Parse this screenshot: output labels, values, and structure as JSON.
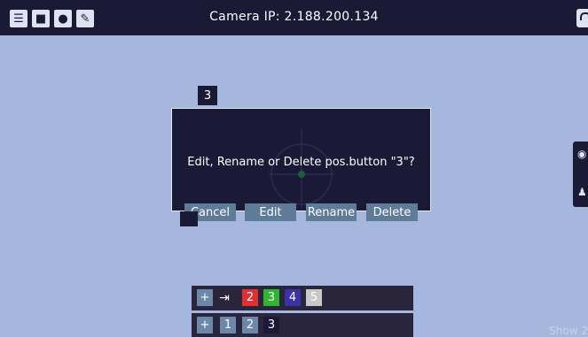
{
  "topbar": {
    "title": "Camera IP: 2.188.200.134",
    "icons": [
      "sliders-icon",
      "camera-icon",
      "user-icon",
      "wrench-icon",
      "lock-icon"
    ]
  },
  "preset_tag": "3",
  "dialog": {
    "message": "Edit, Rename or Delete pos.button \"3\"?",
    "buttons": {
      "cancel": "Cancel",
      "edit": "Edit",
      "rename": "Rename",
      "delete": "Delete"
    }
  },
  "preset_row1": {
    "add": "+",
    "buttons": [
      {
        "label": "2",
        "color": "#e03030"
      },
      {
        "label": "3",
        "color": "#2fb52f"
      },
      {
        "label": "4",
        "color": "#3a33a8"
      },
      {
        "label": "5",
        "color": "#c8c8c8"
      }
    ]
  },
  "preset_row2": {
    "add": "+",
    "buttons": [
      {
        "label": "1",
        "color": "#6c87a8"
      },
      {
        "label": "2",
        "color": "#6c87a8"
      },
      {
        "label": "3",
        "color": "#1b1a36"
      }
    ]
  },
  "footer": {
    "show_label": "Show 2"
  },
  "colors": {
    "background": "#a6b7dd",
    "dark": "#1b1a36",
    "button": "#5e7b97"
  }
}
